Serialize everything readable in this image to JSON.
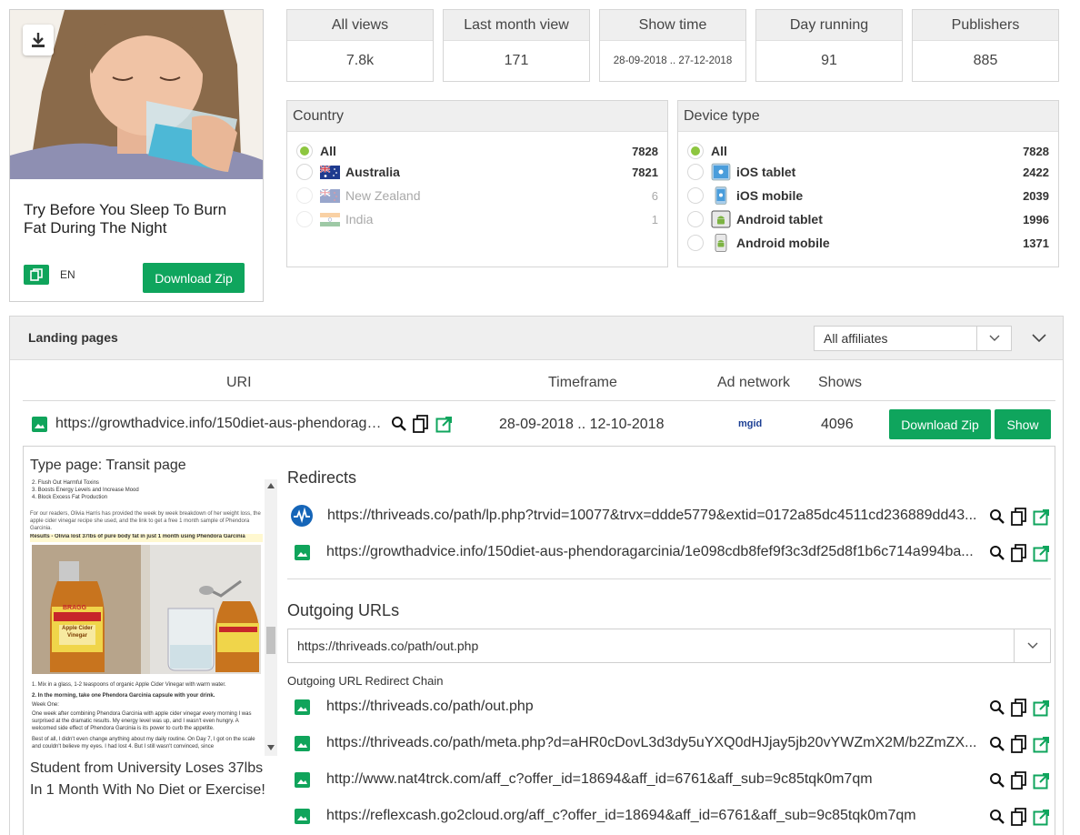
{
  "ad": {
    "title": "Try Before You Sleep To Burn Fat During The Night",
    "lang": "EN",
    "download_label": "Download Zip"
  },
  "stats": [
    {
      "label": "All views",
      "value": "7.8k"
    },
    {
      "label": "Last month view",
      "value": "171"
    },
    {
      "label": "Show time",
      "value": "28-09-2018 .. 27-12-2018"
    },
    {
      "label": "Day running",
      "value": "91"
    },
    {
      "label": "Publishers",
      "value": "885"
    }
  ],
  "country": {
    "title": "Country",
    "options": [
      {
        "label": "All",
        "count": "7828",
        "selected": true
      },
      {
        "label": "Australia",
        "count": "7821"
      },
      {
        "label": "New Zealand",
        "count": "6"
      },
      {
        "label": "India",
        "count": "1"
      }
    ]
  },
  "device": {
    "title": "Device type",
    "options": [
      {
        "label": "All",
        "count": "7828",
        "selected": true
      },
      {
        "label": "iOS tablet",
        "count": "2422",
        "icon": "ios-tablet-icon"
      },
      {
        "label": "iOS mobile",
        "count": "2039",
        "icon": "ios-mobile-icon"
      },
      {
        "label": "Android tablet",
        "count": "1996",
        "icon": "android-tablet-icon"
      },
      {
        "label": "Android mobile",
        "count": "1371",
        "icon": "android-mobile-icon"
      }
    ]
  },
  "landing": {
    "title": "Landing pages",
    "affiliate_filter": "All affiliates",
    "columns": {
      "uri": "URI",
      "timeframe": "Timeframe",
      "ad_network": "Ad network",
      "shows": "Shows"
    },
    "row": {
      "uri": "https://growthadvice.info/150diet-aus-phendoragarcinia/",
      "timeframe": "28-09-2018 .. 12-10-2018",
      "ad_network": "mgid",
      "shows": "4096",
      "download_label": "Download Zip",
      "show_label": "Show"
    },
    "detail": {
      "type_page": "Type page: Transit page",
      "preview": {
        "list": [
          "2. Flush Out Harmful Toxins",
          "3. Boosts Energy Levels and Increase Mood",
          "4. Block Excess Fat Production"
        ],
        "intro": "For our readers, Olivia Harris has provided the week by week breakdown of her weight loss, the apple cider vinegar recipe she used, and the link to get a free 1 month sample of Phendora Garcinia.",
        "results": "Results - Olivia lost 37lbs of pure body fat in just 1 month using Phendora Garcinia",
        "step1": "1. Mix in a glass, 1-2 teaspoons of organic Apple Cider Vinegar with warm water.",
        "step2": "2. In the morning, take one Phendora Garcinia capsule with your drink.",
        "week": "Week One:",
        "para1": "One week after combining Phendora Garcinia with apple cider vinegar every morning I was surprised at the dramatic results. My energy level was up, and I wasn't even hungry. A welcomed side effect of Phendora Garcinia is its power to curb the appetite.",
        "para2": "Best of all, I didn't even change anything about my daily routine. On Day 7, I got on the scale and couldn't believe my eyes. I had lost 4. But I still wasn't convinced, since",
        "bottle_brand": "BRAGG",
        "bottle_label": "Apple Cider Vinegar"
      },
      "caption": "Student from University Loses 37lbs In 1 Month With No Diet or Exercise!",
      "redirects_title": "Redirects",
      "redirects": [
        {
          "url": "https://thriveads.co/path/lp.php?trvid=10077&trvx=ddde5779&extid=0172a85dc4511cd236889dd43...",
          "icon": "network-pulse-icon"
        },
        {
          "url": "https://growthadvice.info/150diet-aus-phendoragarcinia/1e098cdb8fef9f3c3df25d8f1b6c714a994ba...",
          "icon": "image-icon"
        }
      ],
      "outgoing_title": "Outgoing URLs",
      "outgoing_selected": "https://thriveads.co/path/out.php",
      "chain_label": "Outgoing URL Redirect Chain",
      "chain": [
        "https://thriveads.co/path/out.php",
        "https://thriveads.co/path/meta.php?d=aHR0cDovL3d3dy5uYXQ0dHJjay5jb20vYWZmX2M/b2ZmZX...",
        "http://www.nat4trck.com/aff_c?offer_id=18694&aff_id=6761&aff_sub=9c85tqk0m7qm",
        "https://reflexcash.go2cloud.org/aff_c?offer_id=18694&aff_id=6761&aff_sub=9c85tqk0m7qm"
      ]
    }
  },
  "colors": {
    "accent_green": "#0fa55d",
    "radio_on": "#8dc63f",
    "header_bg": "#efefef",
    "mgid_blue": "#1c3f94"
  }
}
